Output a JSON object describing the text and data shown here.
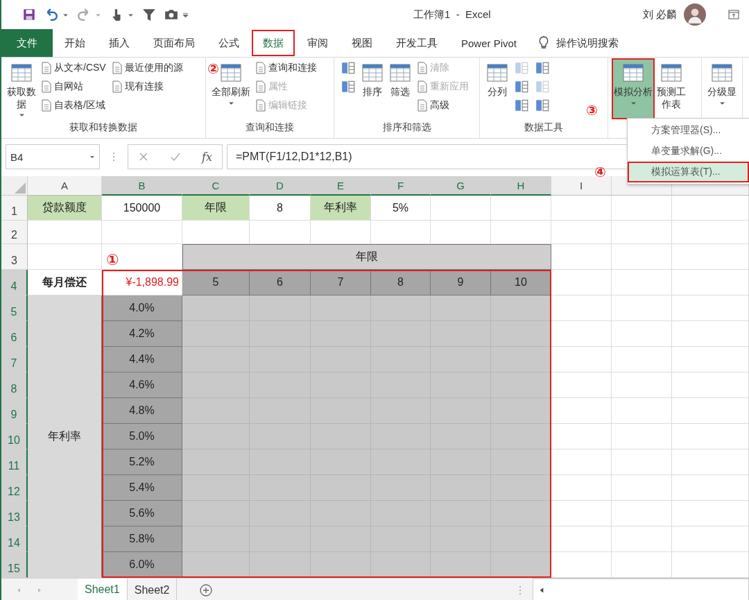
{
  "title_bar": {
    "title": "工作簿1  -  Excel",
    "user": "刘 必麟"
  },
  "ribbon_tabs": [
    {
      "label": "文件",
      "kind": "file",
      "selected": false,
      "boxed": false
    },
    {
      "label": "开始",
      "kind": "tab",
      "selected": false,
      "boxed": false
    },
    {
      "label": "插入",
      "kind": "tab",
      "selected": false,
      "boxed": false
    },
    {
      "label": "页面布局",
      "kind": "tab",
      "selected": false,
      "boxed": false
    },
    {
      "label": "公式",
      "kind": "tab",
      "selected": false,
      "boxed": false
    },
    {
      "label": "数据",
      "kind": "tab",
      "selected": true,
      "boxed": true
    },
    {
      "label": "审阅",
      "kind": "tab",
      "selected": false,
      "boxed": false
    },
    {
      "label": "视图",
      "kind": "tab",
      "selected": false,
      "boxed": false
    },
    {
      "label": "开发工具",
      "kind": "tab",
      "selected": false,
      "boxed": false
    },
    {
      "label": "Power Pivot",
      "kind": "tab",
      "selected": false,
      "boxed": false
    }
  ],
  "tell_me": {
    "label": "操作说明搜索"
  },
  "ribbon_groups": [
    {
      "label": "获取和转换数据",
      "items": [
        {
          "kind": "large",
          "label": "获取数据",
          "wrap": true,
          "dropdown": true,
          "disabled": false
        },
        {
          "kind": "small",
          "label": "从文本/CSV",
          "disabled": false
        },
        {
          "kind": "small",
          "label": "自网站",
          "disabled": false
        },
        {
          "kind": "small",
          "label": "自表格/区域",
          "disabled": false
        },
        {
          "kind": "small",
          "label": "最近使用的源",
          "disabled": false
        },
        {
          "kind": "small",
          "label": "现有连接",
          "disabled": false
        }
      ]
    },
    {
      "label": "查询和连接",
      "items": [
        {
          "kind": "large",
          "label": "全部刷新",
          "dropdown": true,
          "disabled": false,
          "marker": "②"
        },
        {
          "kind": "small",
          "label": "查询和连接",
          "disabled": false
        },
        {
          "kind": "small",
          "label": "属性",
          "disabled": true
        },
        {
          "kind": "small",
          "label": "编辑链接",
          "disabled": true
        }
      ]
    },
    {
      "label": "排序和筛选",
      "items": [
        {
          "kind": "icon",
          "disabled": false
        },
        {
          "kind": "icon",
          "disabled": false
        },
        {
          "kind": "large",
          "label": "排序",
          "disabled": false
        },
        {
          "kind": "large",
          "label": "筛选",
          "disabled": false
        },
        {
          "kind": "small",
          "label": "清除",
          "disabled": true
        },
        {
          "kind": "small",
          "label": "重新应用",
          "disabled": true
        },
        {
          "kind": "small",
          "label": "高级",
          "disabled": false
        }
      ]
    },
    {
      "label": "数据工具",
      "items": [
        {
          "kind": "large",
          "label": "分列",
          "disabled": false
        },
        {
          "kind": "icon",
          "disabled": true
        },
        {
          "kind": "icon",
          "disabled": false
        },
        {
          "kind": "icon",
          "disabled": false
        },
        {
          "kind": "icon",
          "disabled": false
        },
        {
          "kind": "icon",
          "disabled": true
        },
        {
          "kind": "icon",
          "disabled": false
        }
      ]
    },
    {
      "items": [
        {
          "kind": "large",
          "label": "模拟分析",
          "dropdown": true,
          "disabled": false,
          "selected": true,
          "boxed": true,
          "marker": "③"
        },
        {
          "kind": "large",
          "label": "预测工作表",
          "wrap": true,
          "disabled": false,
          "selected": false,
          "boxed": false
        }
      ]
    },
    {
      "items": [
        {
          "kind": "large",
          "label": "分级显",
          "dropdown": true,
          "disabled": false
        }
      ]
    }
  ],
  "menu": {
    "items": [
      {
        "label": "方案管理器(S)...",
        "selected": false,
        "boxed": false
      },
      {
        "label": "单变量求解(G)...",
        "selected": false,
        "boxed": false
      },
      {
        "label": "模拟运算表(T)...",
        "selected": true,
        "boxed": true,
        "marker": "④"
      }
    ]
  },
  "formula_bar": {
    "name_box": "B4",
    "fx": "fx",
    "formula": "=PMT(F1/12,D1*12,B1)"
  },
  "sheet": {
    "side_label": {
      "text": "年利率"
    },
    "columns": [
      {
        "label": "A",
        "selected": false
      },
      {
        "label": "B",
        "selected": true
      },
      {
        "label": "C",
        "selected": true
      },
      {
        "label": "D",
        "selected": true
      },
      {
        "label": "E",
        "selected": true
      },
      {
        "label": "F",
        "selected": true
      },
      {
        "label": "G",
        "selected": true
      },
      {
        "label": "H",
        "selected": true
      },
      {
        "label": "I",
        "selected": false
      },
      {
        "selected": false
      },
      {
        "selected": false
      }
    ],
    "rows": [
      {
        "header": "1",
        "selected": false,
        "cells": [
          {
            "kind": "label",
            "text": "贷款额度"
          },
          {
            "kind": "value",
            "text": "150000"
          },
          {
            "kind": "label",
            "text": "年限"
          },
          {
            "kind": "value",
            "text": "8"
          },
          {
            "kind": "label",
            "text": "年利率"
          },
          {
            "kind": "value",
            "text": "5%"
          },
          {
            "kind": "blank"
          },
          {
            "kind": "blank"
          },
          {
            "kind": "blank"
          },
          {
            "kind": "blank"
          },
          {
            "kind": "blank"
          }
        ]
      },
      {
        "header": "2",
        "selected": false,
        "cells": [
          {
            "kind": "blank"
          },
          {
            "kind": "blank"
          },
          {
            "kind": "blank"
          },
          {
            "kind": "blank"
          },
          {
            "kind": "blank"
          },
          {
            "kind": "blank"
          },
          {
            "kind": "blank"
          },
          {
            "kind": "blank"
          },
          {
            "kind": "blank"
          },
          {
            "kind": "blank"
          },
          {
            "kind": "blank"
          }
        ]
      },
      {
        "header": "3",
        "selected": false,
        "cells": [
          {
            "kind": "blank"
          },
          {
            "kind": "marker",
            "text": "①"
          },
          {
            "kind": "header",
            "text": "年限"
          },
          {
            "kind": "merged"
          },
          {
            "kind": "merged"
          },
          {
            "kind": "merged"
          },
          {
            "kind": "merged"
          },
          {
            "kind": "merged"
          },
          {
            "kind": "blank"
          },
          {
            "kind": "blank"
          },
          {
            "kind": "blank"
          }
        ]
      },
      {
        "header": "4",
        "selected": true,
        "cells": [
          {
            "kind": "bold",
            "text": "每月偿还"
          },
          {
            "kind": "result",
            "text": "¥-1,898.99"
          },
          {
            "kind": "term",
            "text": "5"
          },
          {
            "kind": "term",
            "text": "6"
          },
          {
            "kind": "term",
            "text": "7"
          },
          {
            "kind": "term",
            "text": "8"
          },
          {
            "kind": "term",
            "text": "9"
          },
          {
            "kind": "term",
            "text": "10"
          },
          {
            "kind": "blank"
          },
          {
            "kind": "blank"
          },
          {
            "kind": "blank"
          }
        ]
      },
      {
        "header": "5",
        "selected": true,
        "cells": [
          {
            "kind": "rate",
            "text": "4.0%"
          },
          {
            "kind": "shade"
          },
          {
            "kind": "shade"
          },
          {
            "kind": "shade"
          },
          {
            "kind": "shade"
          },
          {
            "kind": "shade"
          },
          {
            "kind": "shade"
          },
          {
            "kind": "blank"
          },
          {
            "kind": "blank"
          },
          {
            "kind": "blank"
          }
        ]
      },
      {
        "header": "6",
        "selected": true,
        "cells": [
          {
            "kind": "rate",
            "text": "4.2%"
          },
          {
            "kind": "shade"
          },
          {
            "kind": "shade"
          },
          {
            "kind": "shade"
          },
          {
            "kind": "shade"
          },
          {
            "kind": "shade"
          },
          {
            "kind": "shade"
          },
          {
            "kind": "blank"
          },
          {
            "kind": "blank"
          },
          {
            "kind": "blank"
          }
        ]
      },
      {
        "header": "7",
        "selected": true,
        "cells": [
          {
            "kind": "rate",
            "text": "4.4%"
          },
          {
            "kind": "shade"
          },
          {
            "kind": "shade"
          },
          {
            "kind": "shade"
          },
          {
            "kind": "shade"
          },
          {
            "kind": "shade"
          },
          {
            "kind": "shade"
          },
          {
            "kind": "blank"
          },
          {
            "kind": "blank"
          },
          {
            "kind": "blank"
          }
        ]
      },
      {
        "header": "8",
        "selected": true,
        "cells": [
          {
            "kind": "rate",
            "text": "4.6%"
          },
          {
            "kind": "shade"
          },
          {
            "kind": "shade"
          },
          {
            "kind": "shade"
          },
          {
            "kind": "shade"
          },
          {
            "kind": "shade"
          },
          {
            "kind": "shade"
          },
          {
            "kind": "blank"
          },
          {
            "kind": "blank"
          },
          {
            "kind": "blank"
          }
        ]
      },
      {
        "header": "9",
        "selected": true,
        "cells": [
          {
            "kind": "rate",
            "text": "4.8%"
          },
          {
            "kind": "shade"
          },
          {
            "kind": "shade"
          },
          {
            "kind": "shade"
          },
          {
            "kind": "shade"
          },
          {
            "kind": "shade"
          },
          {
            "kind": "shade"
          },
          {
            "kind": "blank"
          },
          {
            "kind": "blank"
          },
          {
            "kind": "blank"
          }
        ]
      },
      {
        "header": "10",
        "selected": true,
        "cells": [
          {
            "kind": "rate",
            "text": "5.0%"
          },
          {
            "kind": "shade"
          },
          {
            "kind": "shade"
          },
          {
            "kind": "shade"
          },
          {
            "kind": "shade"
          },
          {
            "kind": "shade"
          },
          {
            "kind": "shade"
          },
          {
            "kind": "blank"
          },
          {
            "kind": "blank"
          },
          {
            "kind": "blank"
          }
        ]
      },
      {
        "header": "11",
        "selected": true,
        "cells": [
          {
            "kind": "rate",
            "text": "5.2%"
          },
          {
            "kind": "shade"
          },
          {
            "kind": "shade"
          },
          {
            "kind": "shade"
          },
          {
            "kind": "shade"
          },
          {
            "kind": "shade"
          },
          {
            "kind": "shade"
          },
          {
            "kind": "blank"
          },
          {
            "kind": "blank"
          },
          {
            "kind": "blank"
          }
        ]
      },
      {
        "header": "12",
        "selected": true,
        "cells": [
          {
            "kind": "rate",
            "text": "5.4%"
          },
          {
            "kind": "shade"
          },
          {
            "kind": "shade"
          },
          {
            "kind": "shade"
          },
          {
            "kind": "shade"
          },
          {
            "kind": "shade"
          },
          {
            "kind": "shade"
          },
          {
            "kind": "blank"
          },
          {
            "kind": "blank"
          },
          {
            "kind": "blank"
          }
        ]
      },
      {
        "header": "13",
        "selected": true,
        "cells": [
          {
            "kind": "rate",
            "text": "5.6%"
          },
          {
            "kind": "shade"
          },
          {
            "kind": "shade"
          },
          {
            "kind": "shade"
          },
          {
            "kind": "shade"
          },
          {
            "kind": "shade"
          },
          {
            "kind": "shade"
          },
          {
            "kind": "blank"
          },
          {
            "kind": "blank"
          },
          {
            "kind": "blank"
          }
        ]
      },
      {
        "header": "14",
        "selected": true,
        "cells": [
          {
            "kind": "rate",
            "text": "5.8%"
          },
          {
            "kind": "shade"
          },
          {
            "kind": "shade"
          },
          {
            "kind": "shade"
          },
          {
            "kind": "shade"
          },
          {
            "kind": "shade"
          },
          {
            "kind": "shade"
          },
          {
            "kind": "blank"
          },
          {
            "kind": "blank"
          },
          {
            "kind": "blank"
          }
        ]
      },
      {
        "header": "15",
        "selected": true,
        "cells": [
          {
            "kind": "rate",
            "text": "6.0%"
          },
          {
            "kind": "shade"
          },
          {
            "kind": "shade"
          },
          {
            "kind": "shade"
          },
          {
            "kind": "shade"
          },
          {
            "kind": "shade"
          },
          {
            "kind": "shade"
          },
          {
            "kind": "blank"
          },
          {
            "kind": "blank"
          },
          {
            "kind": "blank"
          }
        ]
      }
    ]
  },
  "sheet_tabs": [
    {
      "label": "Sheet1",
      "selected": true
    },
    {
      "label": "Sheet2",
      "selected": false
    }
  ]
}
